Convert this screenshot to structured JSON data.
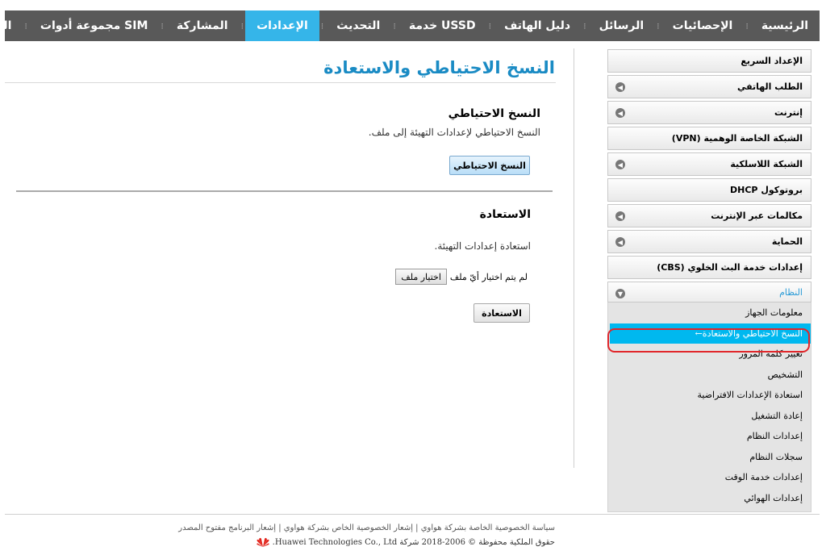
{
  "nav": {
    "items": [
      {
        "label": "الرئيسية",
        "active": false
      },
      {
        "label": "الإحصائيات",
        "active": false
      },
      {
        "label": "الرسائل",
        "active": false
      },
      {
        "label": "دليل الهاتف",
        "active": false
      },
      {
        "label": "خدمة USSD",
        "active": false
      },
      {
        "label": "التحديث",
        "active": false
      },
      {
        "label": "الإعدادات",
        "active": true
      },
      {
        "label": "المشاركة",
        "active": false
      },
      {
        "label": "مجموعة أدوات SIM",
        "active": false
      },
      {
        "label": "المزيد",
        "active": false
      }
    ],
    "active_color": "#35b5e9",
    "bar_color": "#595959"
  },
  "main": {
    "title": "النسخ الاحتياطي والاستعادة",
    "backup": {
      "heading": "النسخ الاحتياطي",
      "description": "النسخ الاحتياطي لإعدادات التهيئة إلى ملف.",
      "button": "النسخ الاحتياطي"
    },
    "restore": {
      "heading": "الاستعادة",
      "description": "استعادة إعدادات التهيئة.",
      "file_button": "اختيار ملف",
      "file_status": "لم يتم اختيار أيّ ملف",
      "button": "الاستعادة"
    }
  },
  "sidebar": {
    "items": [
      {
        "label": "الإعداد السريع",
        "arrow": false
      },
      {
        "label": "الطلب الهاتفي",
        "arrow": true
      },
      {
        "label": "إنترنت",
        "arrow": true
      },
      {
        "label": "الشبكة الخاصة الوهمية (VPN)",
        "arrow": false
      },
      {
        "label": "الشبكة اللاسلكية",
        "arrow": true
      },
      {
        "label": "بروتوكول DHCP",
        "arrow": false
      },
      {
        "label": "مكالمات عبر الإنترنت",
        "arrow": true
      },
      {
        "label": "الحماية",
        "arrow": true
      },
      {
        "label": "إعدادات خدمة البث الخلوي (CBS)",
        "arrow": false
      }
    ],
    "open_section": "النظام",
    "submenu": [
      {
        "label": "معلومات الجهاز",
        "active": false
      },
      {
        "label": "النسخ الاحتياطي والاستعادة←",
        "active": true
      },
      {
        "label": "تغيير كلمة المرور",
        "active": false
      },
      {
        "label": "التشخيص",
        "active": false
      },
      {
        "label": "استعادة الإعدادات الافتراضية",
        "active": false
      },
      {
        "label": "إعادة التشغيل",
        "active": false
      },
      {
        "label": "إعدادات النظام",
        "active": false
      },
      {
        "label": "سجلات النظام",
        "active": false
      },
      {
        "label": "إعدادات خدمة الوقت",
        "active": false
      },
      {
        "label": "إعدادات الهوائي",
        "active": false
      }
    ],
    "active_color": "#00b8ef"
  },
  "footer": {
    "links": "سياسة الخصوصية الخاصة بشركة هواوي | إشعار الخصوصية الخاص بشركة هواوي | إشعار البرنامج مفتوح المصدر",
    "copyright": "حقوق الملكية محفوظة © 2006-2018 شركة Huawei Technologies Co., Ltd."
  }
}
